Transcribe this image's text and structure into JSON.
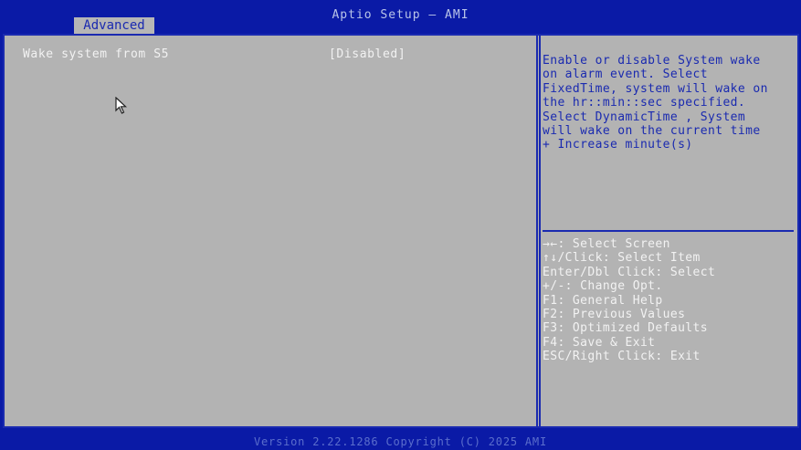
{
  "header": {
    "title": "Aptio Setup – AMI",
    "tabs": [
      {
        "label": "Advanced"
      }
    ]
  },
  "settings": [
    {
      "label": "Wake system from S5",
      "value": "[Disabled]"
    }
  ],
  "help": {
    "description": "Enable or disable System wake\non alarm event. Select\nFixedTime, system will wake on\nthe hr::min::sec specified.\nSelect DynamicTime , System\nwill wake on the current time\n+ Increase minute(s)"
  },
  "keys": [
    "→←: Select Screen",
    "↑↓/Click: Select Item",
    "Enter/Dbl Click: Select",
    "+/-: Change Opt.",
    "F1: General Help",
    "F2: Previous Values",
    "F3: Optimized Defaults",
    "F4: Save & Exit",
    "ESC/Right Click: Exit"
  ],
  "footer": {
    "text": "Version 2.22.1286 Copyright (C) 2025 AMI"
  },
  "colors": {
    "frame_blue": "#0a1aa6",
    "panel_gray": "#b3b3b3",
    "help_text_blue": "#1a2ab0",
    "key_text_white": "#f2f2f2"
  },
  "icons": {
    "pointer": "mouse-pointer-icon"
  }
}
